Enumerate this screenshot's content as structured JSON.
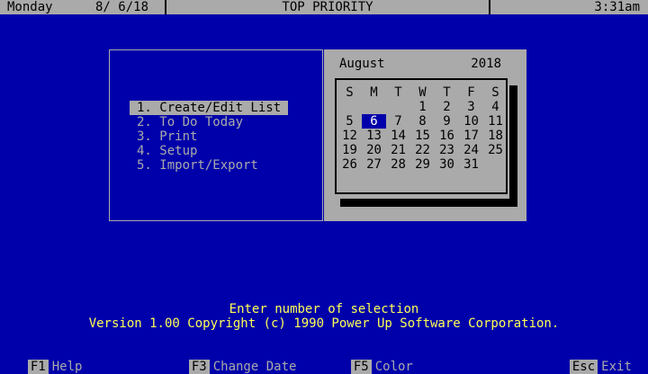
{
  "header": {
    "day": "Monday",
    "date": "8/ 6/18",
    "title": "TOP PRIORITY",
    "time": "3:31am"
  },
  "menu": {
    "items": [
      {
        "label": "1. Create/Edit List"
      },
      {
        "label": "2. To Do Today"
      },
      {
        "label": "3. Print"
      },
      {
        "label": "4. Setup"
      },
      {
        "label": "5. Import/Export"
      }
    ],
    "selected_index": 0
  },
  "calendar": {
    "month": "August",
    "year": "2018",
    "weekdays": [
      "S",
      "M",
      "T",
      "W",
      "T",
      "F",
      "S"
    ],
    "first_weekday_index": 3,
    "days_in_month": 31,
    "selected_day": 6
  },
  "messages": {
    "prompt": "Enter number of selection",
    "copyright": "Version 1.00 Copyright (c) 1990 Power Up Software Corporation."
  },
  "function_keys": [
    {
      "key": "F1",
      "label": "Help"
    },
    {
      "key": "F3",
      "label": "Change Date"
    },
    {
      "key": "F5",
      "label": "Color"
    },
    {
      "key": "Esc",
      "label": "Exit"
    }
  ],
  "colors": {
    "background": "#0000aa",
    "panel": "#aaaaaa",
    "highlight": "#ffff55",
    "text": "#aaaaaa"
  }
}
